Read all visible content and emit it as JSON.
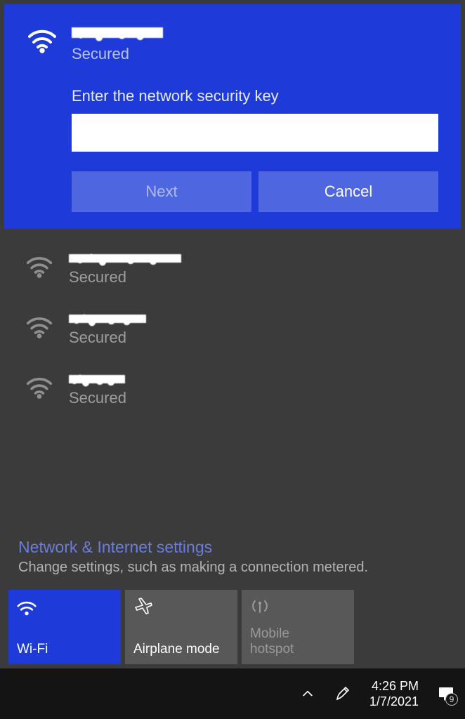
{
  "active_network": {
    "status": "Secured",
    "prompt": "Enter the network security key",
    "input_value": "",
    "next_label": "Next",
    "cancel_label": "Cancel"
  },
  "networks": [
    {
      "status": "Secured"
    },
    {
      "status": "Secured"
    },
    {
      "status": "Secured"
    }
  ],
  "settings": {
    "title": "Network & Internet settings",
    "subtitle": "Change settings, such as making a connection metered."
  },
  "tiles": {
    "wifi": "Wi-Fi",
    "airplane": "Airplane mode",
    "hotspot_top": "Mobile",
    "hotspot_bottom": "hotspot"
  },
  "taskbar": {
    "time": "4:26 PM",
    "date": "1/7/2021",
    "notif_count": "9"
  }
}
